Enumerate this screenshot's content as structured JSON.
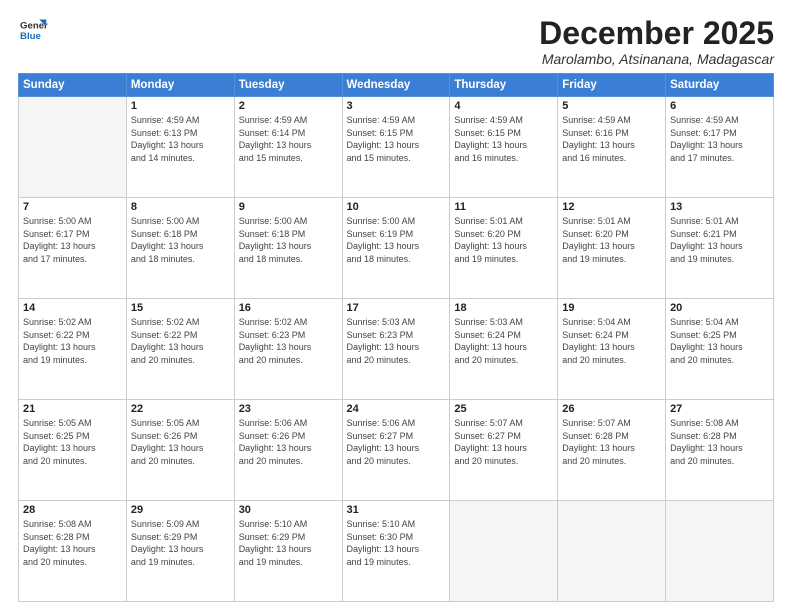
{
  "logo": {
    "general": "General",
    "blue": "Blue"
  },
  "header": {
    "month_year": "December 2025",
    "location": "Marolambo, Atsinanana, Madagascar"
  },
  "weekdays": [
    "Sunday",
    "Monday",
    "Tuesday",
    "Wednesday",
    "Thursday",
    "Friday",
    "Saturday"
  ],
  "weeks": [
    [
      {
        "day": "",
        "info": ""
      },
      {
        "day": "1",
        "info": "Sunrise: 4:59 AM\nSunset: 6:13 PM\nDaylight: 13 hours\nand 14 minutes."
      },
      {
        "day": "2",
        "info": "Sunrise: 4:59 AM\nSunset: 6:14 PM\nDaylight: 13 hours\nand 15 minutes."
      },
      {
        "day": "3",
        "info": "Sunrise: 4:59 AM\nSunset: 6:15 PM\nDaylight: 13 hours\nand 15 minutes."
      },
      {
        "day": "4",
        "info": "Sunrise: 4:59 AM\nSunset: 6:15 PM\nDaylight: 13 hours\nand 16 minutes."
      },
      {
        "day": "5",
        "info": "Sunrise: 4:59 AM\nSunset: 6:16 PM\nDaylight: 13 hours\nand 16 minutes."
      },
      {
        "day": "6",
        "info": "Sunrise: 4:59 AM\nSunset: 6:17 PM\nDaylight: 13 hours\nand 17 minutes."
      }
    ],
    [
      {
        "day": "7",
        "info": "Sunrise: 5:00 AM\nSunset: 6:17 PM\nDaylight: 13 hours\nand 17 minutes."
      },
      {
        "day": "8",
        "info": "Sunrise: 5:00 AM\nSunset: 6:18 PM\nDaylight: 13 hours\nand 18 minutes."
      },
      {
        "day": "9",
        "info": "Sunrise: 5:00 AM\nSunset: 6:18 PM\nDaylight: 13 hours\nand 18 minutes."
      },
      {
        "day": "10",
        "info": "Sunrise: 5:00 AM\nSunset: 6:19 PM\nDaylight: 13 hours\nand 18 minutes."
      },
      {
        "day": "11",
        "info": "Sunrise: 5:01 AM\nSunset: 6:20 PM\nDaylight: 13 hours\nand 19 minutes."
      },
      {
        "day": "12",
        "info": "Sunrise: 5:01 AM\nSunset: 6:20 PM\nDaylight: 13 hours\nand 19 minutes."
      },
      {
        "day": "13",
        "info": "Sunrise: 5:01 AM\nSunset: 6:21 PM\nDaylight: 13 hours\nand 19 minutes."
      }
    ],
    [
      {
        "day": "14",
        "info": "Sunrise: 5:02 AM\nSunset: 6:22 PM\nDaylight: 13 hours\nand 19 minutes."
      },
      {
        "day": "15",
        "info": "Sunrise: 5:02 AM\nSunset: 6:22 PM\nDaylight: 13 hours\nand 20 minutes."
      },
      {
        "day": "16",
        "info": "Sunrise: 5:02 AM\nSunset: 6:23 PM\nDaylight: 13 hours\nand 20 minutes."
      },
      {
        "day": "17",
        "info": "Sunrise: 5:03 AM\nSunset: 6:23 PM\nDaylight: 13 hours\nand 20 minutes."
      },
      {
        "day": "18",
        "info": "Sunrise: 5:03 AM\nSunset: 6:24 PM\nDaylight: 13 hours\nand 20 minutes."
      },
      {
        "day": "19",
        "info": "Sunrise: 5:04 AM\nSunset: 6:24 PM\nDaylight: 13 hours\nand 20 minutes."
      },
      {
        "day": "20",
        "info": "Sunrise: 5:04 AM\nSunset: 6:25 PM\nDaylight: 13 hours\nand 20 minutes."
      }
    ],
    [
      {
        "day": "21",
        "info": "Sunrise: 5:05 AM\nSunset: 6:25 PM\nDaylight: 13 hours\nand 20 minutes."
      },
      {
        "day": "22",
        "info": "Sunrise: 5:05 AM\nSunset: 6:26 PM\nDaylight: 13 hours\nand 20 minutes."
      },
      {
        "day": "23",
        "info": "Sunrise: 5:06 AM\nSunset: 6:26 PM\nDaylight: 13 hours\nand 20 minutes."
      },
      {
        "day": "24",
        "info": "Sunrise: 5:06 AM\nSunset: 6:27 PM\nDaylight: 13 hours\nand 20 minutes."
      },
      {
        "day": "25",
        "info": "Sunrise: 5:07 AM\nSunset: 6:27 PM\nDaylight: 13 hours\nand 20 minutes."
      },
      {
        "day": "26",
        "info": "Sunrise: 5:07 AM\nSunset: 6:28 PM\nDaylight: 13 hours\nand 20 minutes."
      },
      {
        "day": "27",
        "info": "Sunrise: 5:08 AM\nSunset: 6:28 PM\nDaylight: 13 hours\nand 20 minutes."
      }
    ],
    [
      {
        "day": "28",
        "info": "Sunrise: 5:08 AM\nSunset: 6:28 PM\nDaylight: 13 hours\nand 20 minutes."
      },
      {
        "day": "29",
        "info": "Sunrise: 5:09 AM\nSunset: 6:29 PM\nDaylight: 13 hours\nand 19 minutes."
      },
      {
        "day": "30",
        "info": "Sunrise: 5:10 AM\nSunset: 6:29 PM\nDaylight: 13 hours\nand 19 minutes."
      },
      {
        "day": "31",
        "info": "Sunrise: 5:10 AM\nSunset: 6:30 PM\nDaylight: 13 hours\nand 19 minutes."
      },
      {
        "day": "",
        "info": ""
      },
      {
        "day": "",
        "info": ""
      },
      {
        "day": "",
        "info": ""
      }
    ]
  ]
}
